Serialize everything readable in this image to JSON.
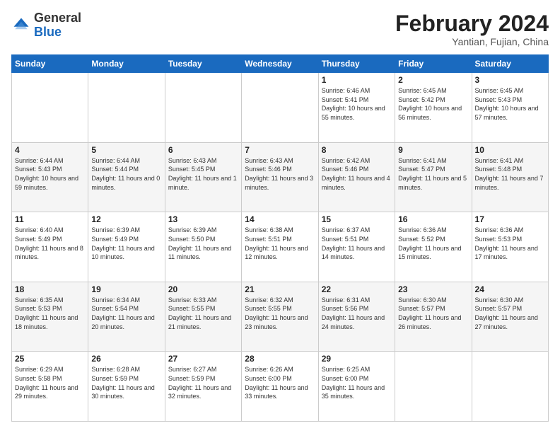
{
  "header": {
    "logo_general": "General",
    "logo_blue": "Blue",
    "month_title": "February 2024",
    "subtitle": "Yantian, Fujian, China"
  },
  "days_of_week": [
    "Sunday",
    "Monday",
    "Tuesday",
    "Wednesday",
    "Thursday",
    "Friday",
    "Saturday"
  ],
  "weeks": [
    [
      {
        "day": "",
        "info": ""
      },
      {
        "day": "",
        "info": ""
      },
      {
        "day": "",
        "info": ""
      },
      {
        "day": "",
        "info": ""
      },
      {
        "day": "1",
        "info": "Sunrise: 6:46 AM\nSunset: 5:41 PM\nDaylight: 10 hours and 55 minutes."
      },
      {
        "day": "2",
        "info": "Sunrise: 6:45 AM\nSunset: 5:42 PM\nDaylight: 10 hours and 56 minutes."
      },
      {
        "day": "3",
        "info": "Sunrise: 6:45 AM\nSunset: 5:43 PM\nDaylight: 10 hours and 57 minutes."
      }
    ],
    [
      {
        "day": "4",
        "info": "Sunrise: 6:44 AM\nSunset: 5:43 PM\nDaylight: 10 hours and 59 minutes."
      },
      {
        "day": "5",
        "info": "Sunrise: 6:44 AM\nSunset: 5:44 PM\nDaylight: 11 hours and 0 minutes."
      },
      {
        "day": "6",
        "info": "Sunrise: 6:43 AM\nSunset: 5:45 PM\nDaylight: 11 hours and 1 minute."
      },
      {
        "day": "7",
        "info": "Sunrise: 6:43 AM\nSunset: 5:46 PM\nDaylight: 11 hours and 3 minutes."
      },
      {
        "day": "8",
        "info": "Sunrise: 6:42 AM\nSunset: 5:46 PM\nDaylight: 11 hours and 4 minutes."
      },
      {
        "day": "9",
        "info": "Sunrise: 6:41 AM\nSunset: 5:47 PM\nDaylight: 11 hours and 5 minutes."
      },
      {
        "day": "10",
        "info": "Sunrise: 6:41 AM\nSunset: 5:48 PM\nDaylight: 11 hours and 7 minutes."
      }
    ],
    [
      {
        "day": "11",
        "info": "Sunrise: 6:40 AM\nSunset: 5:49 PM\nDaylight: 11 hours and 8 minutes."
      },
      {
        "day": "12",
        "info": "Sunrise: 6:39 AM\nSunset: 5:49 PM\nDaylight: 11 hours and 10 minutes."
      },
      {
        "day": "13",
        "info": "Sunrise: 6:39 AM\nSunset: 5:50 PM\nDaylight: 11 hours and 11 minutes."
      },
      {
        "day": "14",
        "info": "Sunrise: 6:38 AM\nSunset: 5:51 PM\nDaylight: 11 hours and 12 minutes."
      },
      {
        "day": "15",
        "info": "Sunrise: 6:37 AM\nSunset: 5:51 PM\nDaylight: 11 hours and 14 minutes."
      },
      {
        "day": "16",
        "info": "Sunrise: 6:36 AM\nSunset: 5:52 PM\nDaylight: 11 hours and 15 minutes."
      },
      {
        "day": "17",
        "info": "Sunrise: 6:36 AM\nSunset: 5:53 PM\nDaylight: 11 hours and 17 minutes."
      }
    ],
    [
      {
        "day": "18",
        "info": "Sunrise: 6:35 AM\nSunset: 5:53 PM\nDaylight: 11 hours and 18 minutes."
      },
      {
        "day": "19",
        "info": "Sunrise: 6:34 AM\nSunset: 5:54 PM\nDaylight: 11 hours and 20 minutes."
      },
      {
        "day": "20",
        "info": "Sunrise: 6:33 AM\nSunset: 5:55 PM\nDaylight: 11 hours and 21 minutes."
      },
      {
        "day": "21",
        "info": "Sunrise: 6:32 AM\nSunset: 5:55 PM\nDaylight: 11 hours and 23 minutes."
      },
      {
        "day": "22",
        "info": "Sunrise: 6:31 AM\nSunset: 5:56 PM\nDaylight: 11 hours and 24 minutes."
      },
      {
        "day": "23",
        "info": "Sunrise: 6:30 AM\nSunset: 5:57 PM\nDaylight: 11 hours and 26 minutes."
      },
      {
        "day": "24",
        "info": "Sunrise: 6:30 AM\nSunset: 5:57 PM\nDaylight: 11 hours and 27 minutes."
      }
    ],
    [
      {
        "day": "25",
        "info": "Sunrise: 6:29 AM\nSunset: 5:58 PM\nDaylight: 11 hours and 29 minutes."
      },
      {
        "day": "26",
        "info": "Sunrise: 6:28 AM\nSunset: 5:59 PM\nDaylight: 11 hours and 30 minutes."
      },
      {
        "day": "27",
        "info": "Sunrise: 6:27 AM\nSunset: 5:59 PM\nDaylight: 11 hours and 32 minutes."
      },
      {
        "day": "28",
        "info": "Sunrise: 6:26 AM\nSunset: 6:00 PM\nDaylight: 11 hours and 33 minutes."
      },
      {
        "day": "29",
        "info": "Sunrise: 6:25 AM\nSunset: 6:00 PM\nDaylight: 11 hours and 35 minutes."
      },
      {
        "day": "",
        "info": ""
      },
      {
        "day": "",
        "info": ""
      }
    ]
  ]
}
